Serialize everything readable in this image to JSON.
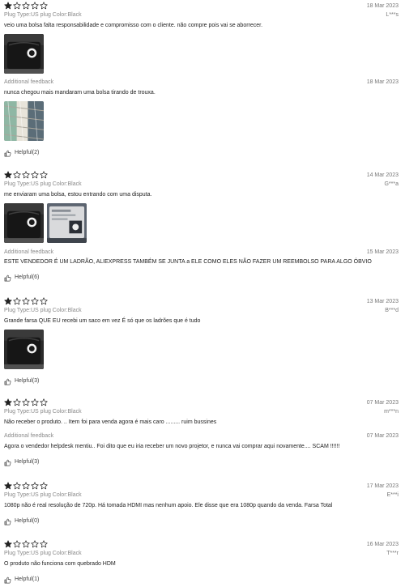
{
  "reviews": [
    {
      "rating": 1,
      "date": "18 Mar 2023",
      "meta": "Plug Type:US plug Color:Black",
      "user": "L***s",
      "text": "veio uma bolsa falta responsabilidade e compromisso com o cliente. não compre pois vai se aborrecer.",
      "photos": [
        "black-bag-photo"
      ],
      "additional": {
        "label": "Additional feedback",
        "date": "18 Mar 2023",
        "text": "nunca chegou mais mandaram uma bolsa tirando de trouxa.",
        "photos": [
          "fabric-photo"
        ]
      },
      "helpful": "Helpful(2)"
    },
    {
      "rating": 1,
      "date": "14 Mar 2023",
      "meta": "Plug Type:US plug Color:Black",
      "user": "G***a",
      "text": "me enviaram uma bolsa, estou entrando com uma disputa.",
      "photos": [
        "black-bag-photo",
        "package-photo"
      ],
      "additional": {
        "label": "Additional feedback",
        "date": "15 Mar 2023",
        "text": "ESTE VENDEDOR É UM LADRÃO, ALIEXPRESS TAMBÉM SE JUNTA a ELE COMO ELES NÃO FAZER UM REEMBOLSO PARA ALGO ÓBVIO"
      },
      "helpful": "Helpful(6)"
    },
    {
      "rating": 1,
      "date": "13 Mar 2023",
      "meta": "Plug Type:US plug Color:Black",
      "user": "B***d",
      "text": "Grande farsa QUE EU recebi um saco em vez É só que os ladrões que é tudo",
      "photos": [
        "black-bag-photo"
      ],
      "helpful": "Helpful(3)"
    },
    {
      "rating": 1,
      "date": "07 Mar 2023",
      "meta": "Plug Type:US plug Color:Black",
      "user": "m***n",
      "text": "Não receber o produto. .. Item foi para venda agora é mais caro ......... ruim bussines",
      "additional": {
        "label": "Additional feedback",
        "date": "07 Mar 2023",
        "text": "Agora o vendedor helpdesk mentiu.. Foi dito que eu iria receber um novo projetor, e nunca vai comprar aqui novamente.... SCAM !!!!!!"
      },
      "helpful": "Helpful(3)"
    },
    {
      "rating": 1,
      "date": "17 Mar 2023",
      "meta": "Plug Type:US plug Color:Black",
      "user": "E***i",
      "text": "1080p não é real resolução de 720p. Há tomada HDMI mas nenhum apoio. Ele disse que era 1080p quando da venda. Farsa Total",
      "helpful": "Helpful(0)"
    },
    {
      "rating": 1,
      "date": "16 Mar 2023",
      "meta": "Plug Type:US plug Color:Black",
      "user": "T***r",
      "text": "O produto não funciona com quebrado HDM",
      "helpful": "Helpful(1)"
    }
  ],
  "colors": {
    "star_filled": "#222222",
    "star_empty": "#222222",
    "muted": "#8a8a8a"
  }
}
